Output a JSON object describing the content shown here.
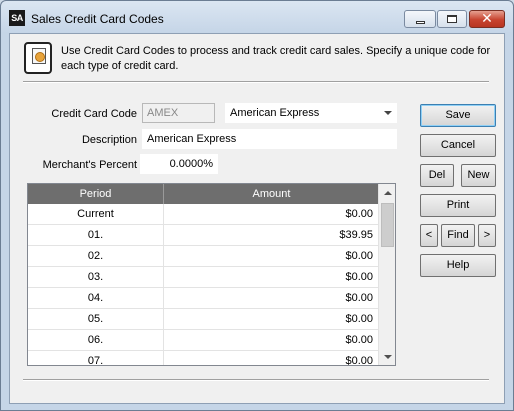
{
  "window": {
    "app_icon_text": "SA",
    "title": "Sales Credit Card Codes",
    "close_glyph": "✕"
  },
  "info": {
    "text": "Use Credit Card Codes to process and track credit card sales. Specify a unique code for each type of credit card."
  },
  "form": {
    "credit_card_code_label": "Credit Card Code",
    "credit_card_code_value": "AMEX",
    "card_name_value": "American Express",
    "description_label": "Description",
    "description_value": "American Express",
    "merchant_percent_label": "Merchant's Percent",
    "merchant_percent_value": "0.0000%"
  },
  "grid": {
    "columns": [
      "Period",
      "Amount"
    ],
    "rows": [
      {
        "period": "Current",
        "amount": "$0.00"
      },
      {
        "period": "01.",
        "amount": "$39.95"
      },
      {
        "period": "02.",
        "amount": "$0.00"
      },
      {
        "period": "03.",
        "amount": "$0.00"
      },
      {
        "period": "04.",
        "amount": "$0.00"
      },
      {
        "period": "05.",
        "amount": "$0.00"
      },
      {
        "period": "06.",
        "amount": "$0.00"
      },
      {
        "period": "07.",
        "amount": "$0.00"
      }
    ]
  },
  "buttons": {
    "save": "Save",
    "cancel": "Cancel",
    "del": "Del",
    "new": "New",
    "print": "Print",
    "prev": "<",
    "find": "Find",
    "next": ">",
    "help": "Help"
  },
  "colors": {
    "grid_header": "#6e6e6e",
    "close_button": "#c7432f",
    "default_button_border": "#3c7fb1"
  }
}
